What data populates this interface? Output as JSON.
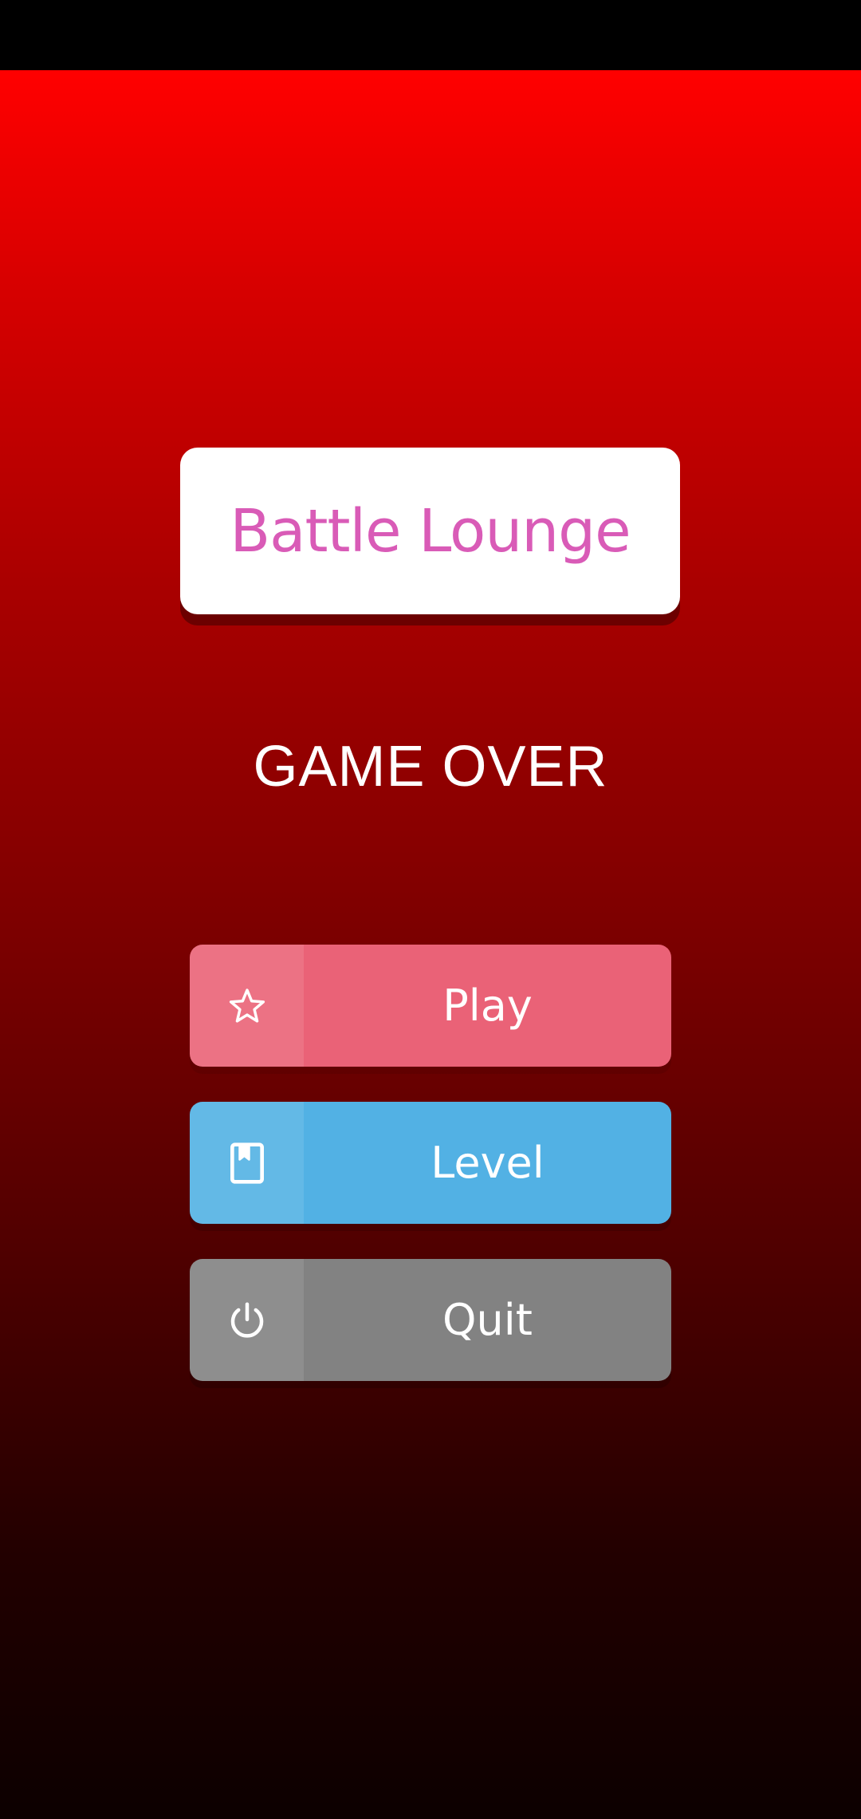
{
  "app": {
    "title": "Battle Lounge",
    "status_text": "GAME OVER"
  },
  "menu": [
    {
      "label": "Play",
      "icon": "star-icon",
      "color": "#ea6277"
    },
    {
      "label": "Level",
      "icon": "book-icon",
      "color": "#52b1e4"
    },
    {
      "label": "Quit",
      "icon": "power-icon",
      "color": "#828282"
    }
  ],
  "colors": {
    "background_top": "#ff0000",
    "background_bottom": "#0c0000",
    "title_text": "#d95bb7"
  }
}
